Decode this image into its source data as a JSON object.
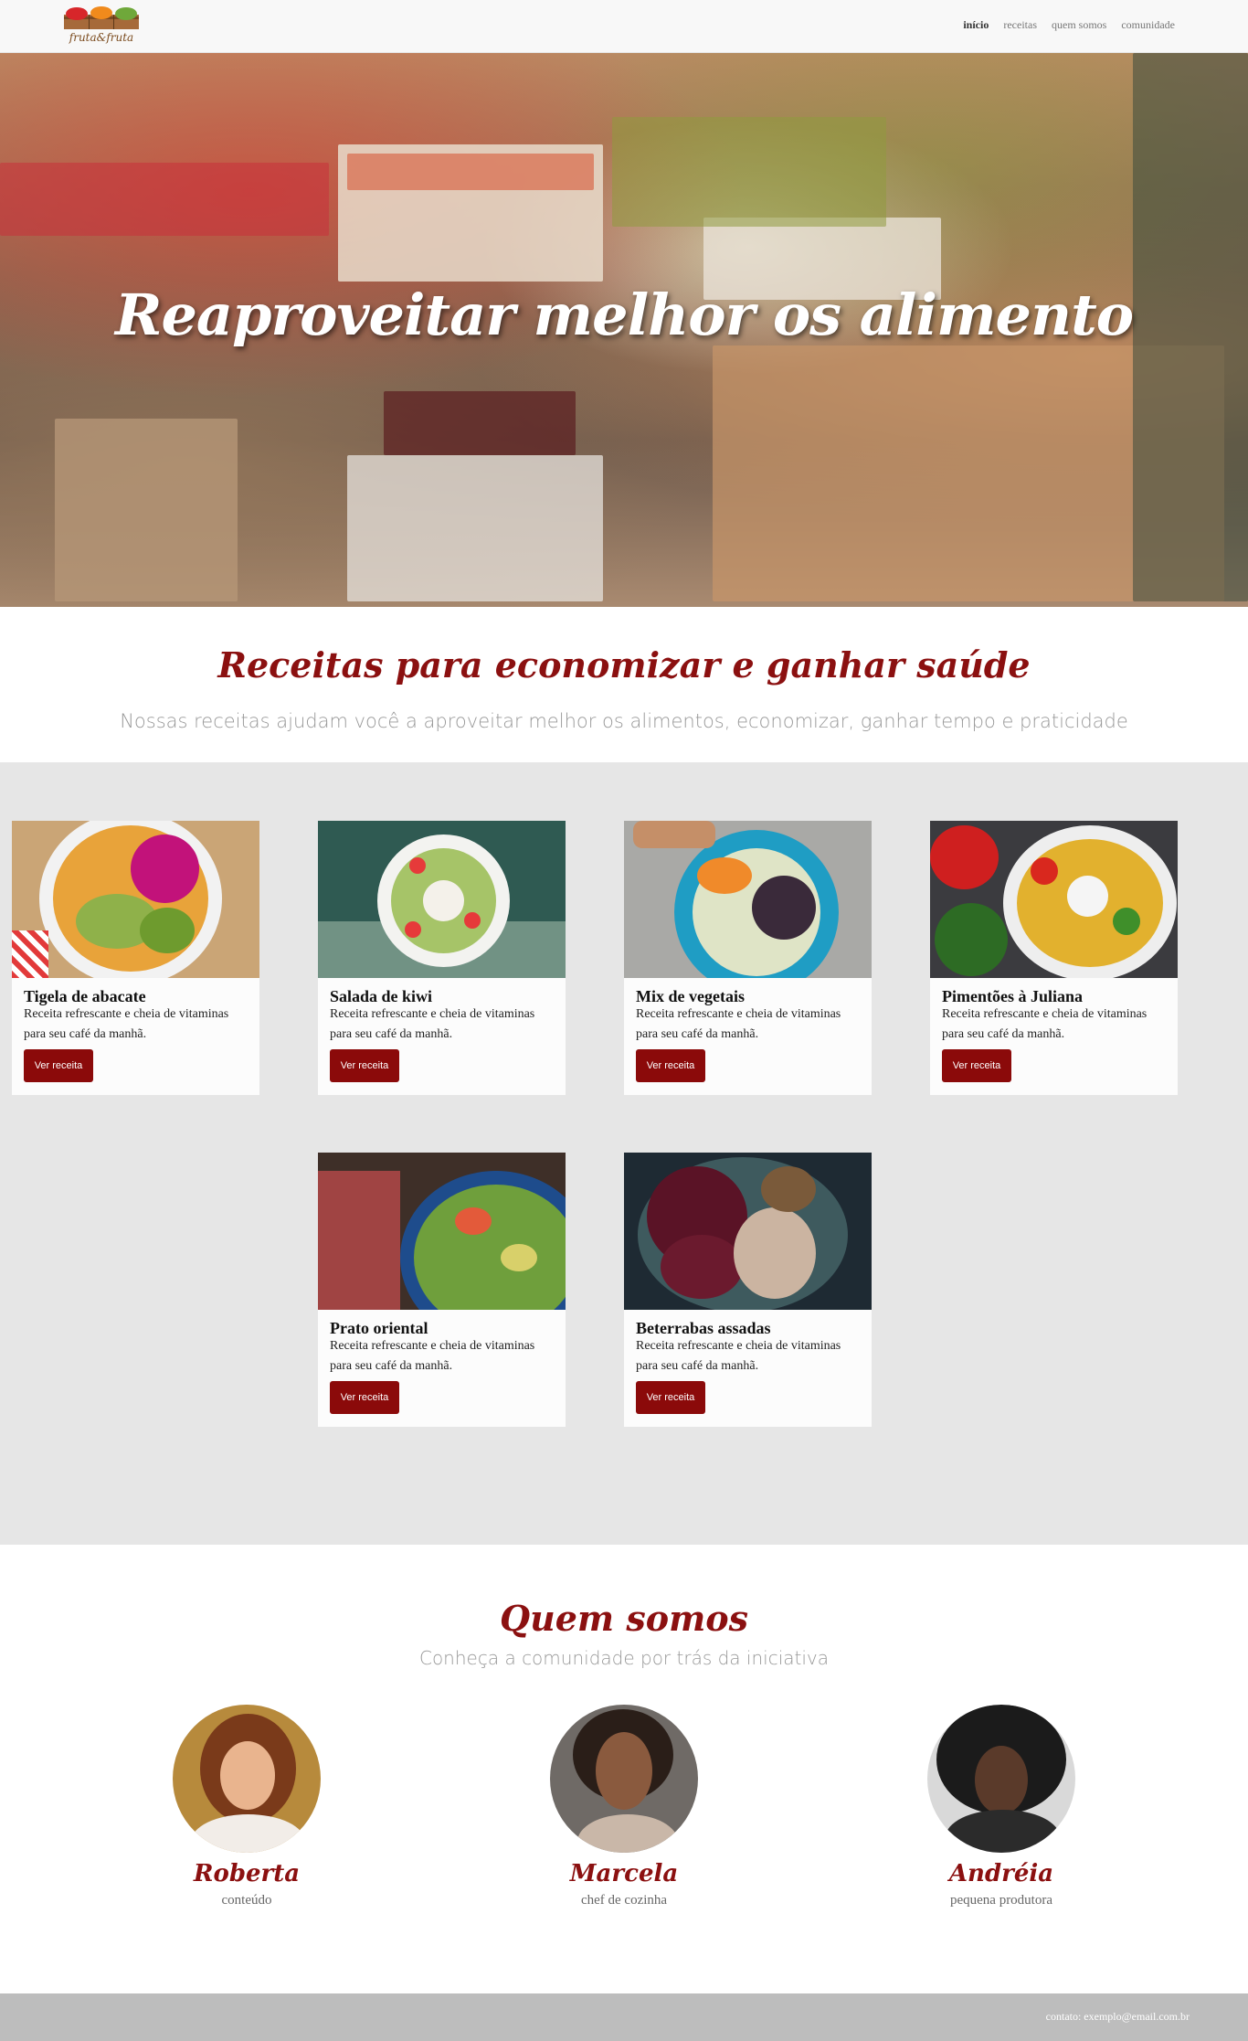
{
  "brand": {
    "logo_text": "fruta&fruta"
  },
  "nav": {
    "items": [
      "início",
      "receitas",
      "quem somos",
      "comunidade"
    ]
  },
  "hero": {
    "title": "Reaproveitar melhor os alimento"
  },
  "recipes_section": {
    "title": "Receitas para economizar e ganhar saúde",
    "subtitle": "Nossas receitas ajudam você a aproveitar melhor os alimentos, economizar, ganhar tempo e praticidade"
  },
  "recipes": [
    {
      "title": "Tigela de abacate",
      "description": "Receita refrescante e cheia de vitaminas para seu café da manhã.",
      "button": "Ver receita"
    },
    {
      "title": "Salada de kiwi",
      "description": "Receita refrescante e cheia de vitaminas para seu café da manhã.",
      "button": "Ver receita"
    },
    {
      "title": "Mix de vegetais",
      "description": "Receita refrescante e cheia de vitaminas para seu café da manhã.",
      "button": "Ver receita"
    },
    {
      "title": "Pimentões à Juliana",
      "description": "Receita refrescante e cheia de vitaminas para seu café da manhã.",
      "button": "Ver receita"
    },
    {
      "title": "Prato oriental",
      "description": "Receita refrescante e cheia de vitaminas para seu café da manhã.",
      "button": "Ver receita"
    },
    {
      "title": "Beterrabas assadas",
      "description": "Receita refrescante e cheia de vitaminas para seu café da manhã.",
      "button": "Ver receita"
    }
  ],
  "about_section": {
    "title": "Quem somos",
    "subtitle": "Conheça a comunidade por trás da iniciativa"
  },
  "team": [
    {
      "name": "Roberta",
      "role": "conteúdo"
    },
    {
      "name": "Marcela",
      "role": "chef de cozinha"
    },
    {
      "name": "Andréia",
      "role": "pequena produtora"
    }
  ],
  "footer": {
    "contact": "contato: exemplo@email.com.br"
  },
  "colors": {
    "accent": "#8b0a0a",
    "recipes_bg": "#e6e6e6",
    "footer_bg": "#bdbdbd"
  }
}
